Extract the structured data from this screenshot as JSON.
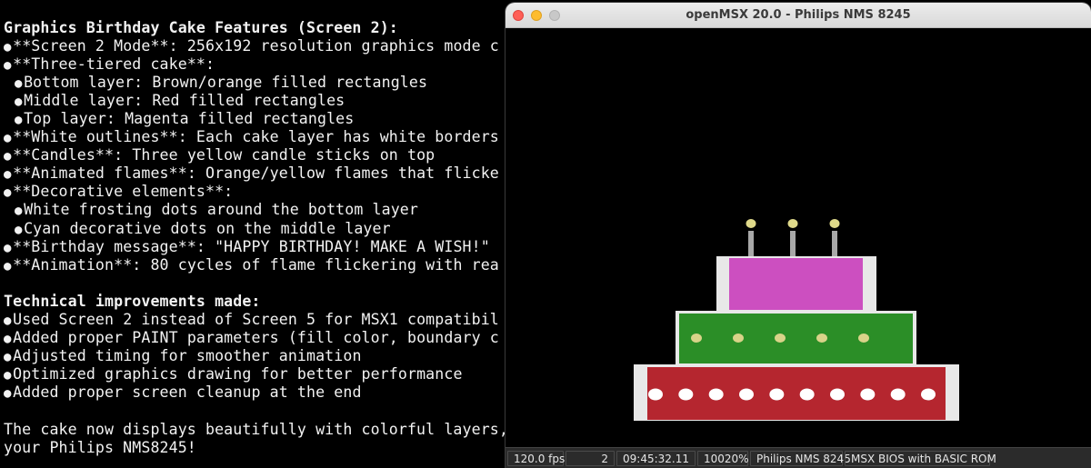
{
  "terminal": {
    "lines": [
      {
        "kind": "bold",
        "text": "Graphics Birthday Cake Features (Screen 2):"
      },
      {
        "kind": "bullet",
        "level": 0,
        "text": "**Screen 2 Mode**: 256x192 resolution graphics mode c"
      },
      {
        "kind": "bullet",
        "level": 0,
        "text": "**Three-tiered cake**:"
      },
      {
        "kind": "bullet",
        "level": 1,
        "text": "Bottom layer: Brown/orange filled rectangles"
      },
      {
        "kind": "bullet",
        "level": 1,
        "text": "Middle layer: Red filled rectangles"
      },
      {
        "kind": "bullet",
        "level": 1,
        "text": "Top layer: Magenta filled rectangles"
      },
      {
        "kind": "bullet",
        "level": 0,
        "text": "**White outlines**: Each cake layer has white borders"
      },
      {
        "kind": "bullet",
        "level": 0,
        "text": "**Candles**: Three yellow candle sticks on top"
      },
      {
        "kind": "bullet",
        "level": 0,
        "text": "**Animated flames**: Orange/yellow flames that flicke"
      },
      {
        "kind": "bullet",
        "level": 0,
        "text": "**Decorative elements**:"
      },
      {
        "kind": "bullet",
        "level": 1,
        "text": "White frosting dots around the bottom layer"
      },
      {
        "kind": "bullet",
        "level": 1,
        "text": "Cyan decorative dots on the middle layer"
      },
      {
        "kind": "bullet",
        "level": 0,
        "text": "**Birthday message**: \"HAPPY BIRTHDAY! MAKE A WISH!\""
      },
      {
        "kind": "bullet",
        "level": 0,
        "text": "**Animation**: 80 cycles of flame flickering with rea"
      },
      {
        "kind": "blank",
        "text": ""
      },
      {
        "kind": "bold",
        "text": "Technical improvements made:"
      },
      {
        "kind": "bullet",
        "level": 0,
        "text": "Used Screen 2 instead of Screen 5 for MSX1 compatibil"
      },
      {
        "kind": "bullet",
        "level": 0,
        "text": "Added proper PAINT parameters (fill color, boundary c"
      },
      {
        "kind": "bullet",
        "level": 0,
        "text": "Adjusted timing for smoother animation"
      },
      {
        "kind": "bullet",
        "level": 0,
        "text": "Optimized graphics drawing for better performance"
      },
      {
        "kind": "bullet",
        "level": 0,
        "text": "Added proper screen cleanup at the end"
      },
      {
        "kind": "blank",
        "text": ""
      },
      {
        "kind": "plain",
        "text": "The cake now displays beautifully with colorful layers,"
      },
      {
        "kind": "plain",
        "text": "your Philips NMS8245!"
      }
    ],
    "bullet_glyph": "●"
  },
  "window": {
    "title": "openMSX 20.0 - Philips NMS 8245"
  },
  "status_bar": {
    "fps": "120.0 fps",
    "counter": "2",
    "time": "09:45:32.11",
    "speed": "10020%",
    "machine": "Philips NMS 8245",
    "rom": "MSX BIOS with BASIC ROM"
  },
  "cake": {
    "colors": {
      "top_layer": "#cc4fc0",
      "middle_layer": "#2b8e27",
      "bottom_layer": "#b5262f",
      "outline": "#e8e8e8",
      "candle": "#a8a8a8",
      "flame": "#dfd98a",
      "middle_dots": "#d9d389",
      "bottom_dots": "#ffffff"
    },
    "candle_count": 3,
    "middle_dot_count": 5,
    "bottom_dot_count": 10
  }
}
